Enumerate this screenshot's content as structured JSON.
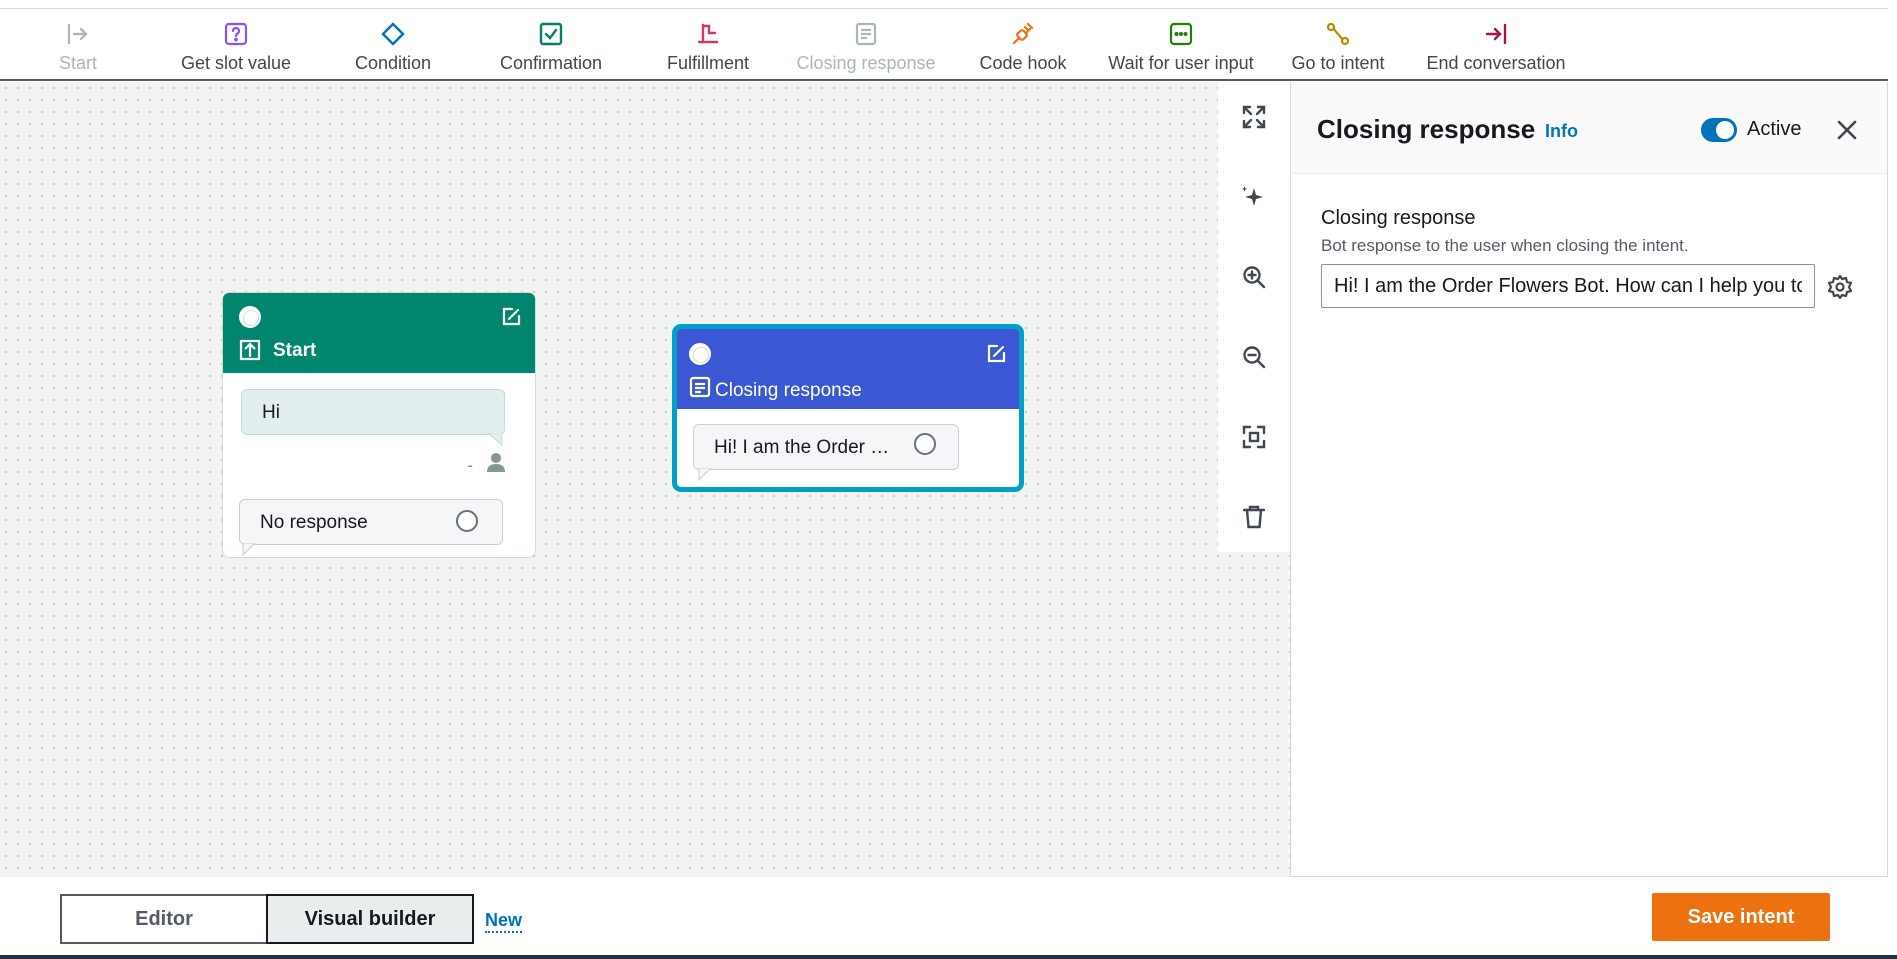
{
  "toolbar": {
    "items": [
      {
        "label": "Start",
        "icon": "arrow-right-to-bar-icon",
        "disabled": true
      },
      {
        "label": "Get slot value",
        "icon": "question-box-icon"
      },
      {
        "label": "Condition",
        "icon": "diamond-icon"
      },
      {
        "label": "Confirmation",
        "icon": "check-box-icon"
      },
      {
        "label": "Fulfillment",
        "icon": "flag-icon"
      },
      {
        "label": "Closing response",
        "icon": "document-icon",
        "disabled": true
      },
      {
        "label": "Code hook",
        "icon": "plug-icon"
      },
      {
        "label": "Wait for user input",
        "icon": "chat-dots-icon"
      },
      {
        "label": "Go to intent",
        "icon": "route-icon"
      },
      {
        "label": "End conversation",
        "icon": "arrow-to-bar-icon"
      }
    ],
    "colors": {
      "start": "#aab7b8",
      "get_slot": "#8c4fff",
      "condition": "#0073bb",
      "confirmation": "#067f68",
      "fulfillment": "#d6336c",
      "closing": "#aab7b8",
      "code_hook": "#ec7211",
      "wait": "#1d8102",
      "goto": "#b88a00",
      "end": "#a3154b"
    }
  },
  "canvas": {
    "start_node": {
      "title": "Start",
      "header_color": "#00866f",
      "user_message": "Hi",
      "user_marker": "-",
      "response": "No response"
    },
    "closing_node": {
      "title": "Closing response",
      "header_color": "#3b57d3",
      "selection_color": "#00a1c9",
      "message_preview": "Hi! I am the Order …"
    },
    "controls": [
      "expand-icon",
      "sparkle-icon",
      "zoom-in-icon",
      "zoom-out-icon",
      "fit-screen-icon",
      "trash-icon"
    ]
  },
  "panel": {
    "title": "Closing response",
    "info_link": "Info",
    "toggle_label": "Active",
    "field_label": "Closing response",
    "field_description": "Bot response to the user when closing the intent.",
    "field_value": "Hi! I am the Order Flowers Bot. How can I help you today?"
  },
  "footer": {
    "tab_editor": "Editor",
    "tab_visual": "Visual builder",
    "new_badge": "New",
    "save_label": "Save intent",
    "save_color": "#ec7211"
  }
}
